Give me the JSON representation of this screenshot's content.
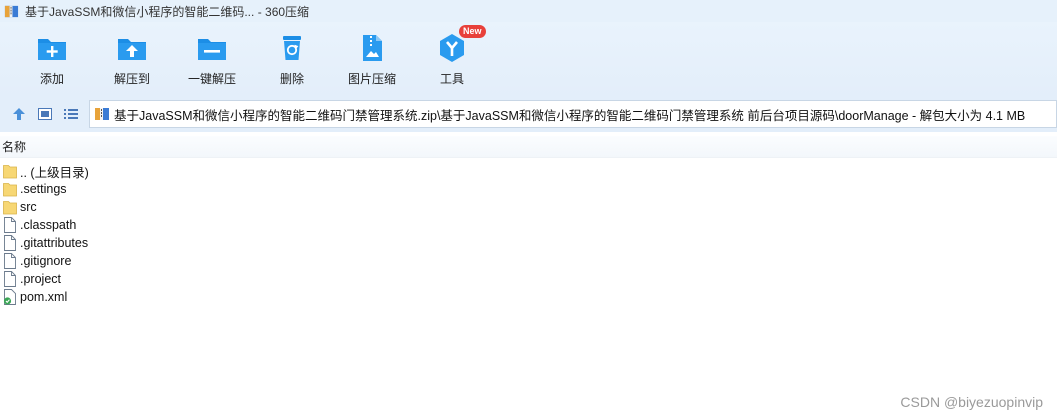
{
  "window": {
    "title": "基于JavaSSM和微信小程序的智能二维码... - 360压缩",
    "app_icon": "zip-archive-icon"
  },
  "toolbar": {
    "items": [
      {
        "id": "add",
        "label": "添加",
        "icon": "folder-add-icon"
      },
      {
        "id": "extract",
        "label": "解压到",
        "icon": "folder-extract-icon"
      },
      {
        "id": "one-click-extract",
        "label": "一键解压",
        "icon": "folder-one-click-icon"
      },
      {
        "id": "delete",
        "label": "删除",
        "icon": "recycle-bin-icon"
      },
      {
        "id": "image-compress",
        "label": "图片压缩",
        "icon": "image-compress-icon"
      },
      {
        "id": "tools",
        "label": "工具",
        "icon": "tools-icon"
      }
    ],
    "tools_badge": "New"
  },
  "navbar": {
    "path": "基于JavaSSM和微信小程序的智能二维码门禁管理系统.zip\\基于JavaSSM和微信小程序的智能二维码门禁管理系统 前后台项目源码\\doorManage - 解包大小为 4.1 MB"
  },
  "columns": {
    "name": "名称"
  },
  "files": [
    {
      "name": ".. (上级目录)",
      "type": "folder"
    },
    {
      "name": ".settings",
      "type": "folder"
    },
    {
      "name": "src",
      "type": "folder"
    },
    {
      "name": ".classpath",
      "type": "file"
    },
    {
      "name": ".gitattributes",
      "type": "file"
    },
    {
      "name": ".gitignore",
      "type": "file"
    },
    {
      "name": ".project",
      "type": "file"
    },
    {
      "name": "pom.xml",
      "type": "xml"
    }
  ],
  "watermark": "CSDN @biyezuopinvip",
  "colors": {
    "toolbar_bg": "#e3eefa",
    "icon_blue": "#1c8ee6",
    "badge_red": "#e8403a",
    "folder_yellow": "#f7d774"
  }
}
